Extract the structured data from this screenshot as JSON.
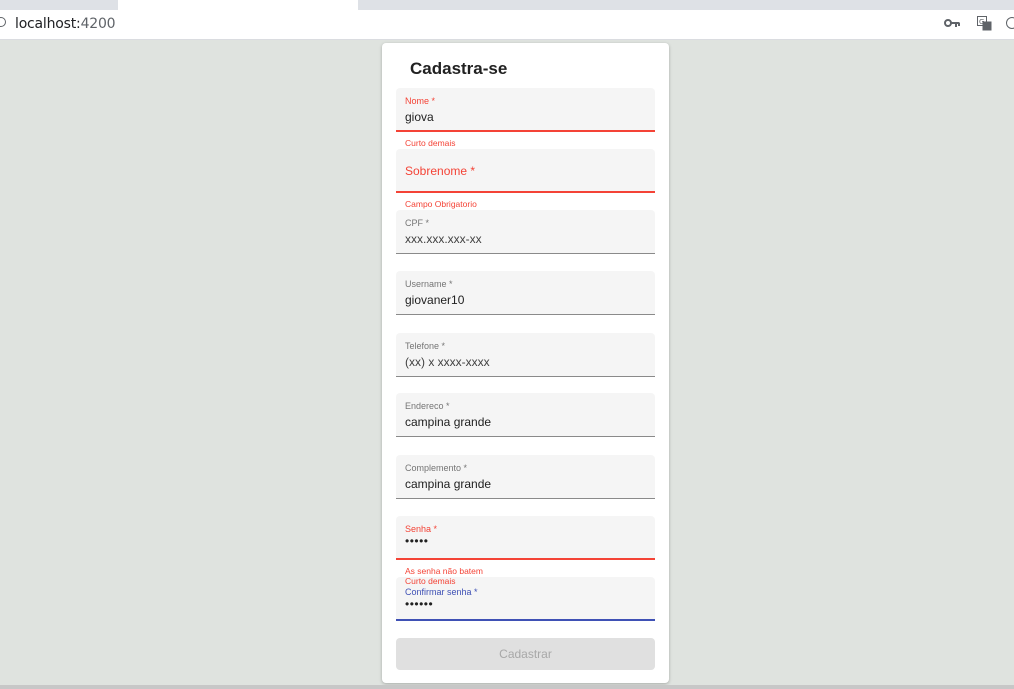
{
  "browser": {
    "url_host": "localhost:",
    "url_port": "4200"
  },
  "form": {
    "title": "Cadastra-se",
    "fields": {
      "nome": {
        "label": "Nome *",
        "value": "giova",
        "hint": "Curto demais"
      },
      "sobrenome": {
        "label": "Sobrenome *",
        "value": "",
        "hint": "Campo Obrigatorio"
      },
      "cpf": {
        "label": "CPF *",
        "value": "xxx.xxx.xxx-xx"
      },
      "username": {
        "label": "Username *",
        "value": "giovaner10"
      },
      "telefone": {
        "label": "Telefone *",
        "value": "(xx) x xxxx-xxxx"
      },
      "endereco": {
        "label": "Endereco *",
        "value": "campina grande"
      },
      "complemento": {
        "label": "Complemento *",
        "value": "campina grande"
      },
      "senha": {
        "label": "Senha *",
        "value": "•••••",
        "hint": "As senha não batem"
      },
      "confirmar": {
        "label": "Confirmar senha *",
        "value": "••••••",
        "hint": "Curto demais"
      }
    },
    "submit_label": "Cadastrar"
  },
  "colors": {
    "error": "#f44336",
    "focus": "#3f51b5",
    "background": "#dfe3df"
  }
}
